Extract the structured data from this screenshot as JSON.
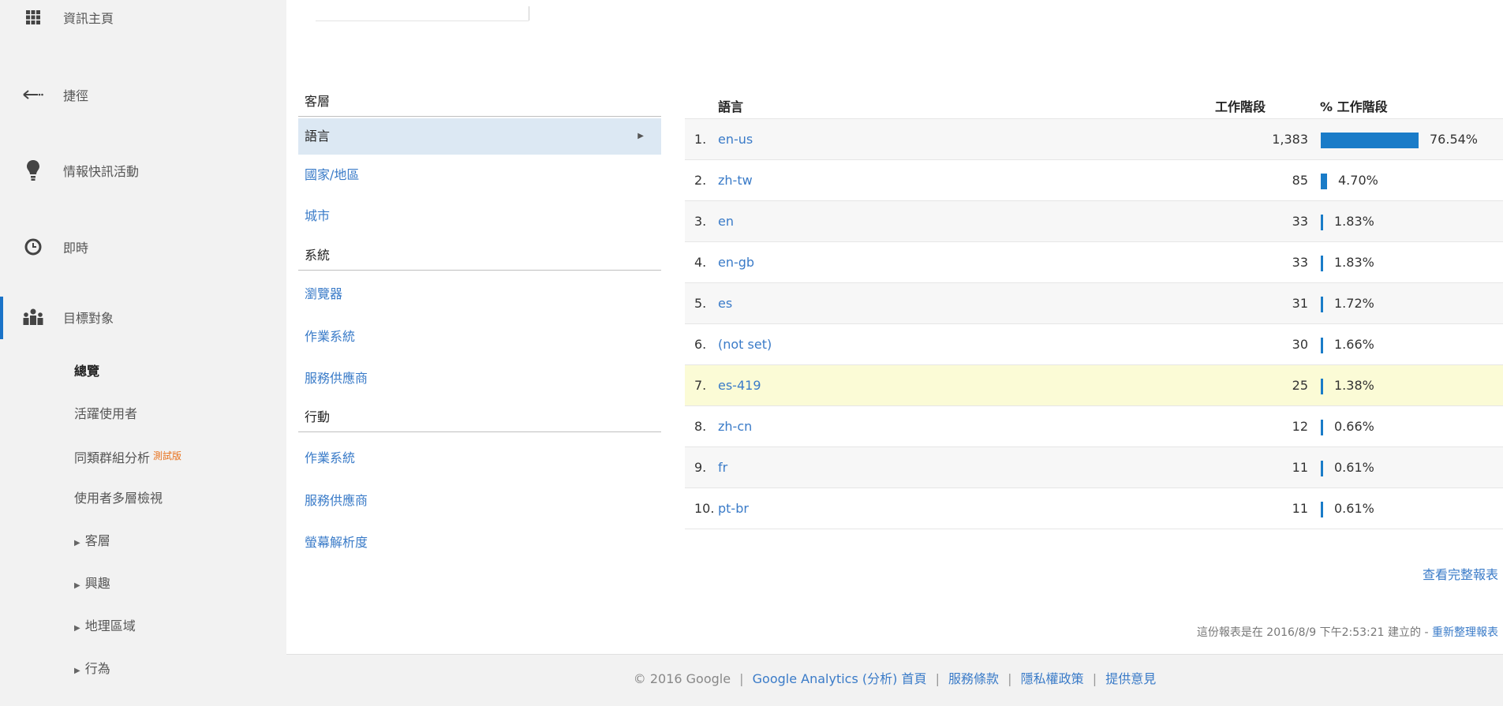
{
  "sidebar": {
    "nav": [
      {
        "label": "資訊主頁",
        "icon": "grid-icon"
      },
      {
        "label": "捷徑",
        "icon": "shortcut-arrow-icon"
      },
      {
        "label": "情報快訊活動",
        "icon": "lightbulb-icon"
      },
      {
        "label": "即時",
        "icon": "clock-icon"
      },
      {
        "label": "目標對象",
        "icon": "people-icon"
      }
    ],
    "audience_sub": [
      {
        "label": "總覽"
      },
      {
        "label": "活躍使用者"
      },
      {
        "label": "同類群組分析",
        "badge": "測試版"
      },
      {
        "label": "使用者多層檢視"
      },
      {
        "label": "客層"
      },
      {
        "label": "興趣"
      },
      {
        "label": "地理區域"
      },
      {
        "label": "行為"
      }
    ]
  },
  "dimension_menu": {
    "groups": [
      {
        "title": "客層",
        "links": [
          "語言",
          "國家/地區",
          "城市"
        ]
      },
      {
        "title": "系統",
        "links": [
          "瀏覽器",
          "作業系統",
          "服務供應商"
        ]
      },
      {
        "title": "行動",
        "links": [
          "作業系統",
          "服務供應商",
          "螢幕解析度"
        ]
      }
    ],
    "selected": "語言"
  },
  "table": {
    "headers": {
      "dimension": "語言",
      "sessions": "工作階段",
      "percent": "% 工作階段"
    },
    "rows": [
      {
        "index": "1.",
        "language": "en-us",
        "sessions": "1,383",
        "percent": "76.54%",
        "fraction": 0.7654
      },
      {
        "index": "2.",
        "language": "zh-tw",
        "sessions": "85",
        "percent": "4.70%",
        "fraction": 0.047
      },
      {
        "index": "3.",
        "language": "en",
        "sessions": "33",
        "percent": "1.83%",
        "fraction": 0.0183
      },
      {
        "index": "4.",
        "language": "en-gb",
        "sessions": "33",
        "percent": "1.83%",
        "fraction": 0.0183
      },
      {
        "index": "5.",
        "language": "es",
        "sessions": "31",
        "percent": "1.72%",
        "fraction": 0.0172
      },
      {
        "index": "6.",
        "language": "(not set)",
        "sessions": "30",
        "percent": "1.66%",
        "fraction": 0.0166
      },
      {
        "index": "7.",
        "language": "es-419",
        "sessions": "25",
        "percent": "1.38%",
        "fraction": 0.0138
      },
      {
        "index": "8.",
        "language": "zh-cn",
        "sessions": "12",
        "percent": "0.66%",
        "fraction": 0.0066
      },
      {
        "index": "9.",
        "language": "fr",
        "sessions": "11",
        "percent": "0.61%",
        "fraction": 0.0061
      },
      {
        "index": "10.",
        "language": "pt-br",
        "sessions": "11",
        "percent": "0.61%",
        "fraction": 0.0061
      }
    ],
    "bar_color": "#1a7cc8",
    "full_report_label": "查看完整報表"
  },
  "report_meta": {
    "text": "這份報表是在 2016/8/9 下午2:53:21 建立的 - ",
    "refresh_label": "重新整理報表"
  },
  "footer": {
    "copyright": "© 2016 Google",
    "links": [
      "Google Analytics (分析) 首頁",
      "服務條款",
      "隱私權政策",
      "提供意見"
    ]
  }
}
